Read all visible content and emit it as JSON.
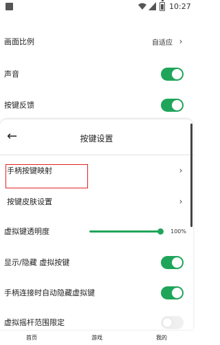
{
  "status_bar": {
    "time": "10:27"
  },
  "settings": {
    "aspect_ratio": {
      "label": "画面比例",
      "value": "自适应"
    },
    "sound": {
      "label": "声音",
      "enabled": true
    },
    "haptic": {
      "label": "按键反馈",
      "enabled": true
    }
  },
  "sheet": {
    "title": "按键设置",
    "items": {
      "gamepad_mapping": {
        "label": "手柄按键映射"
      },
      "key_skin": {
        "label": "按键皮肤设置"
      },
      "opacity": {
        "label": "虚拟键透明度",
        "value": 1.0,
        "value_text": "100%"
      },
      "show_hide_keys": {
        "label": "显示/隐藏 虚拟按键",
        "enabled": true
      },
      "auto_hide_on_gamepad": {
        "label": "手柄连接时自动隐藏虚拟键",
        "enabled": true
      },
      "joystick_range": {
        "label": "虚拟摇杆范围限定",
        "enabled": false
      }
    }
  },
  "bottom_nav": {
    "tabs": [
      {
        "label": "首页"
      },
      {
        "label": "游戏"
      },
      {
        "label": "我的",
        "active": true
      }
    ]
  },
  "colors": {
    "accent": "#1fa55a",
    "highlight_box": "#e02020"
  }
}
